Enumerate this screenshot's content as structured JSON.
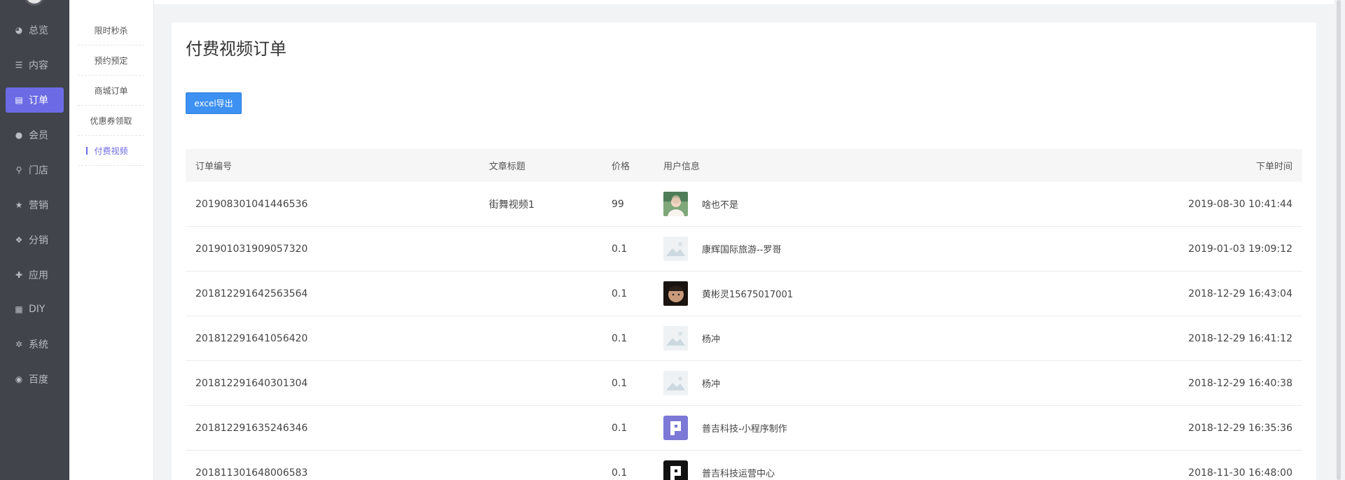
{
  "nav": {
    "items": [
      {
        "label": "总览",
        "icon": "pie-chart-icon",
        "glyph": "◕"
      },
      {
        "label": "内容",
        "icon": "list-icon",
        "glyph": "☰"
      },
      {
        "label": "订单",
        "icon": "document-icon",
        "glyph": "▤",
        "active": true
      },
      {
        "label": "会员",
        "icon": "user-icon",
        "glyph": "●"
      },
      {
        "label": "门店",
        "icon": "location-pin-icon",
        "glyph": "⚲"
      },
      {
        "label": "营销",
        "icon": "star-icon",
        "glyph": "★"
      },
      {
        "label": "分销",
        "icon": "users-icon",
        "glyph": "❖"
      },
      {
        "label": "应用",
        "icon": "puzzle-icon",
        "glyph": "✚"
      },
      {
        "label": "DIY",
        "icon": "layout-icon",
        "glyph": "▦"
      },
      {
        "label": "系统",
        "icon": "gear-icon",
        "glyph": "✲"
      },
      {
        "label": "百度",
        "icon": "baidu-icon",
        "glyph": "◉"
      }
    ]
  },
  "subnav": {
    "items": [
      {
        "label": "限时秒杀"
      },
      {
        "label": "预约预定"
      },
      {
        "label": "商城订单"
      },
      {
        "label": "优惠券领取"
      },
      {
        "label": "付费视频",
        "active": true
      }
    ]
  },
  "page": {
    "title": "付费视频订单",
    "export_label": "excel导出"
  },
  "table": {
    "headers": {
      "id": "订单编号",
      "title": "文章标题",
      "price": "价格",
      "user": "用户信息",
      "time": "下单时间"
    },
    "rows": [
      {
        "id": "201908301041446536",
        "title": "街舞视频1",
        "price": "99",
        "user": "啥也不是",
        "time": "2019-08-30 10:41:44",
        "avatar": "photo-avatar"
      },
      {
        "id": "201901031909057320",
        "title": "",
        "price": "0.1",
        "user": "康辉国际旅游--罗哥",
        "time": "2019-01-03 19:09:12",
        "avatar": "placeholder-avatar"
      },
      {
        "id": "201812291642563564",
        "title": "",
        "price": "0.1",
        "user": "黄彬灵15675017001",
        "time": "2018-12-29 16:43:04",
        "avatar": "child-photo-avatar"
      },
      {
        "id": "201812291641056420",
        "title": "",
        "price": "0.1",
        "user": "杨冲",
        "time": "2018-12-29 16:41:12",
        "avatar": "placeholder-avatar"
      },
      {
        "id": "201812291640301304",
        "title": "",
        "price": "0.1",
        "user": "杨冲",
        "time": "2018-12-29 16:40:38",
        "avatar": "placeholder-avatar"
      },
      {
        "id": "201812291635246346",
        "title": "",
        "price": "0.1",
        "user": "普吉科技-小程序制作",
        "time": "2018-12-29 16:35:36",
        "avatar": "purple-logo-avatar"
      },
      {
        "id": "201811301648006583",
        "title": "",
        "price": "0.1",
        "user": "普吉科技运营中心",
        "time": "2018-11-30 16:48:00",
        "avatar": "black-logo-avatar"
      }
    ]
  },
  "colors": {
    "accent": "#6c6be5",
    "button": "#3c91f2",
    "nav_bg": "#41444b"
  }
}
